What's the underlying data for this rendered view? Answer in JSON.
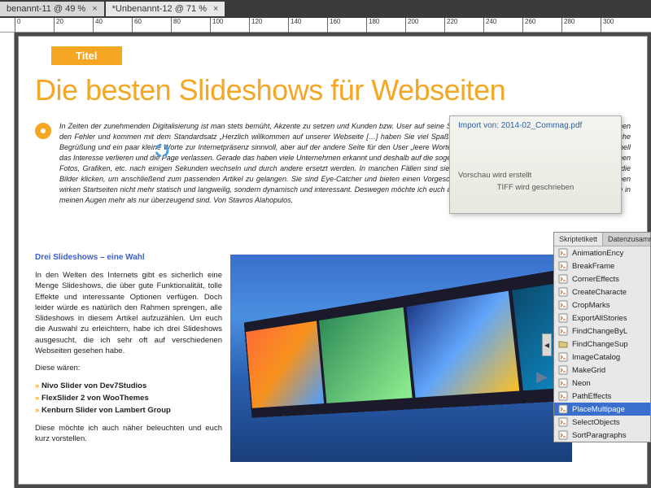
{
  "tabs": [
    {
      "label": "benannt-11 @ 49 %",
      "active": false
    },
    {
      "label": "*Unbenannt-12 @ 71 %",
      "active": true
    }
  ],
  "ruler_ticks": [
    "0",
    "20",
    "40",
    "60",
    "80",
    "100",
    "120",
    "140",
    "160",
    "180",
    "200",
    "220",
    "240",
    "260",
    "280",
    "300"
  ],
  "title_badge": "Titel",
  "headline": "Die besten Slideshows für Webseiten",
  "intro": "In Zeiten der zunehmenden Digitalisierung ist man stets bemüht, Akzente zu setzen und Kunden bzw. User auf seine Seite zu holen. Genau hier Seiten-tenbetreiber begehen den Fehler und kommen mit dem Standardsatz „Herzlich willkommen auf unserer Webseite […] haben Sie viel Spaß beim Durchklicken“ daher. Natürlich sind eine höfliche Begrüßung und ein paar kleine Worte zur Internetpräsenz sinnvoll, aber auf der andere Seite für den User „leere Worte“ nicht aussagekräftig genug, sodass Besucher schnell das Interesse verlieren und die Page verlassen. Gerade das haben viele Unternehmen erkannt und deshalb auf die soge-nannten Slideshows. Das sind Bildergalerien, in denen Fotos, Grafiken, etc. nach einigen Sekunden wechseln und durch andere ersetzt werden. In manchen Fällen sind sie sogar mit etwas Text versehen und man kann auf die Bilder klicken, um anschließend zum passenden Artikel zu gelangen. Sie sind Eye-Catcher und bieten einen Vorgeschmack auf den gesamten Inhalt der Seite. Dank ihnen wirken Startseiten nicht mehr statisch und langweilig, sondern dynamisch und interessant. Deswegen möchte ich euch auch in diesem Artikel drei Slideshows empfehlen, die in meinen Augen mehr als nur überzeugend sind. Von Stavros Alahopulos.",
  "subtitle": "Drei Slideshows – eine Wahl",
  "body_p1": "In den Weiten des Internets gibt es sicherlich eine Menge Slideshows, die über gute Funktionalität, tolle Effekte und interessante Optionen verfügen. Doch leider würde es natürlich den Rahmen sprengen, alle Slideshows in diesem Artikel aufzuzählen. Um euch die Auswahl zu erleichtern, habe ich drei Slideshows ausgesucht, die ich sehr oft auf verschiedenen Webseiten gesehen habe.",
  "body_p2": "Diese wären:",
  "list": [
    "Nivo Slider von Dev7Studios",
    "FlexSlider 2 von WooThemes",
    "Kenburn Slider von Lambert Group"
  ],
  "body_p3": "Diese möchte ich auch näher beleuchten und euch kurz vorstellen.",
  "dialog": {
    "title": "Import von: 2014-02_Commag.pdf",
    "line1": "Vorschau wird erstellt",
    "line2": "TIFF wird geschrieben"
  },
  "panel": {
    "tabs": [
      "Skriptetikett",
      "Datenzusamm"
    ],
    "items": [
      {
        "label": "AnimationEncy",
        "icon": "script"
      },
      {
        "label": "BreakFrame",
        "icon": "script"
      },
      {
        "label": "CornerEffects",
        "icon": "script"
      },
      {
        "label": "CreateCharacte",
        "icon": "script"
      },
      {
        "label": "CropMarks",
        "icon": "script"
      },
      {
        "label": "ExportAllStories",
        "icon": "script"
      },
      {
        "label": "FindChangeByL",
        "icon": "script"
      },
      {
        "label": "FindChangeSup",
        "icon": "folder"
      },
      {
        "label": "ImageCatalog",
        "icon": "script"
      },
      {
        "label": "MakeGrid",
        "icon": "script"
      },
      {
        "label": "Neon",
        "icon": "script"
      },
      {
        "label": "PathEffects",
        "icon": "script"
      },
      {
        "label": "PlaceMultipage",
        "icon": "script",
        "selected": true
      },
      {
        "label": "SelectObjects",
        "icon": "script"
      },
      {
        "label": "SortParagraphs",
        "icon": "script"
      }
    ]
  }
}
